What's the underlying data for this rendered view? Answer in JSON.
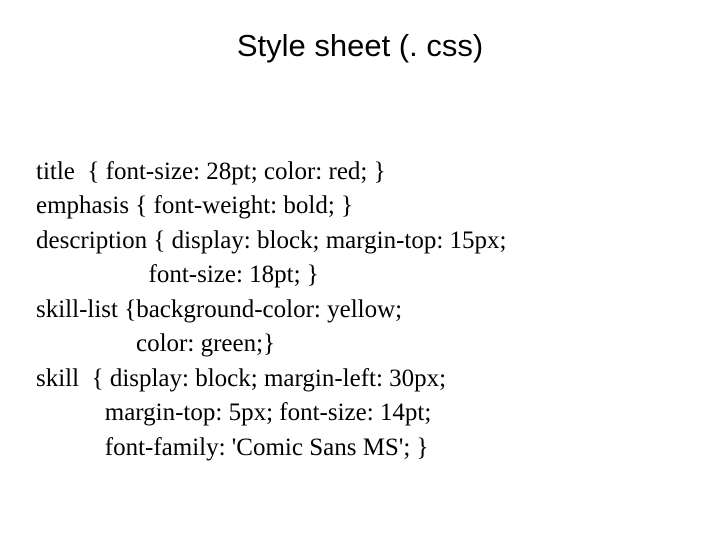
{
  "title": "Style sheet (. css)",
  "code": {
    "l1": "title  { font-size: 28pt; color: red; }",
    "l2": "emphasis { font-weight: bold; }",
    "l3": "description { display: block; margin-top: 15px;",
    "l4": "                  font-size: 18pt; }",
    "l5": "skill-list {background-color: yellow;",
    "l6": "                color: green;}",
    "l7": "skill  { display: block; margin-left: 30px;",
    "l8": "           margin-top: 5px; font-size: 14pt;",
    "l9": "           font-family: 'Comic Sans MS'; }"
  }
}
